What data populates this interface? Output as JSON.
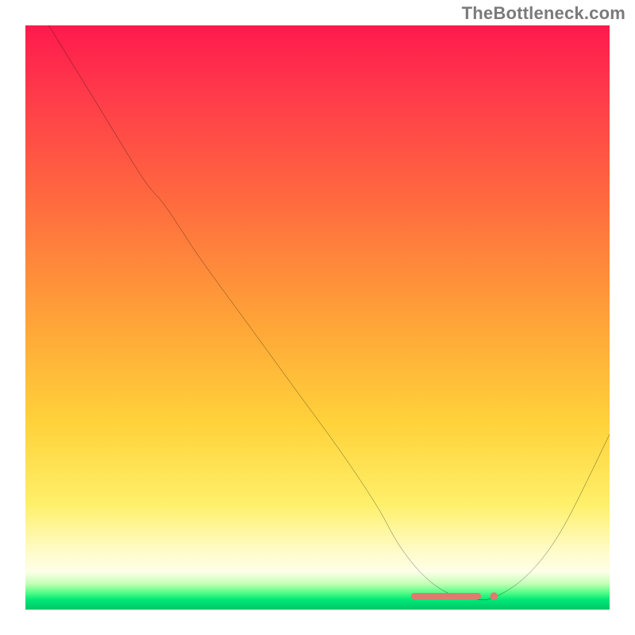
{
  "watermark": "TheBottleneck.com",
  "chart_data": {
    "type": "line",
    "title": "",
    "xlabel": "",
    "ylabel": "",
    "xlim": [
      0,
      100
    ],
    "ylim": [
      0,
      100
    ],
    "grid": false,
    "legend": "none",
    "series": [
      {
        "name": "bottleneck-curve",
        "x": [
          4,
          12,
          20,
          24,
          30,
          38,
          46,
          54,
          60,
          64,
          68,
          72,
          76,
          80,
          86,
          92,
          100
        ],
        "values": [
          100,
          87,
          74,
          69,
          60,
          49,
          38,
          27,
          18,
          11,
          6,
          3,
          2,
          2,
          6,
          14,
          30
        ]
      }
    ],
    "minimum_marker": {
      "x_start": 66,
      "x_end": 78,
      "y": 2.3,
      "color": "#e07a6f"
    },
    "gradient_stops": [
      {
        "pos": 0,
        "color": "#ff1a4d"
      },
      {
        "pos": 50,
        "color": "#ffa238"
      },
      {
        "pos": 82,
        "color": "#fff06a"
      },
      {
        "pos": 97,
        "color": "#5bff8a"
      },
      {
        "pos": 100,
        "color": "#00c768"
      }
    ]
  }
}
